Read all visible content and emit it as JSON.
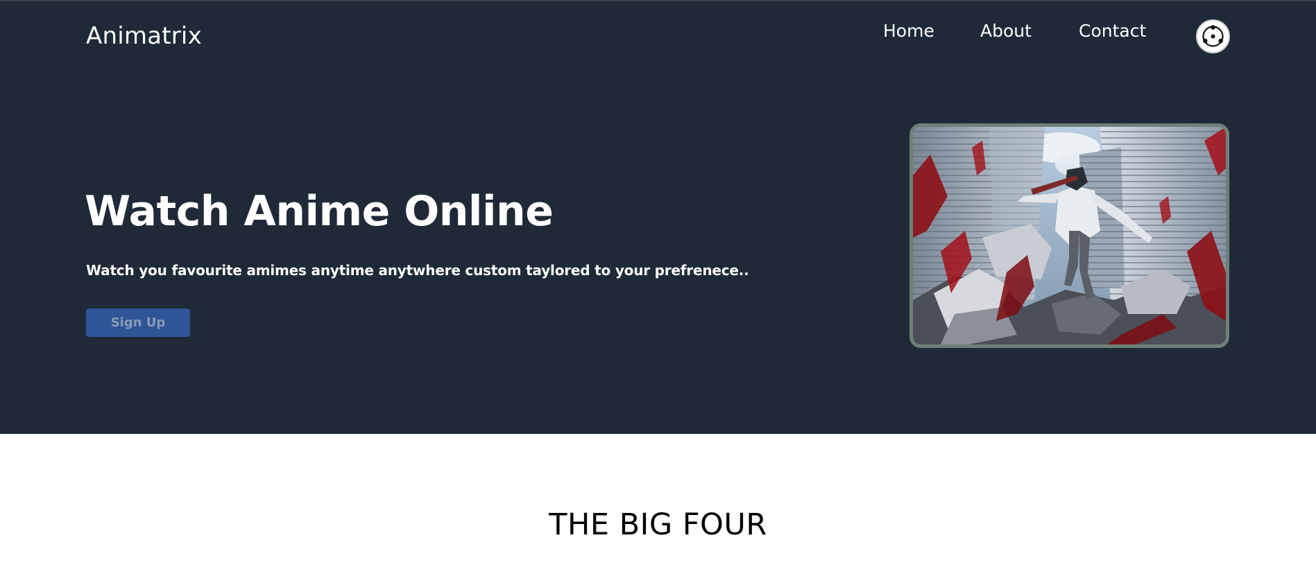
{
  "header": {
    "brand": "Animatrix",
    "nav": {
      "home": "Home",
      "about": "About",
      "contact": "Contact"
    },
    "avatar_icon": "sharingan-icon"
  },
  "hero": {
    "title": "Watch Anime Online",
    "subtitle": "Watch you favourite amimes anytime anytwhere custom taylored to your prefrenece..",
    "signup_label": "Sign Up",
    "image_subject": "anime-action-illustration"
  },
  "section": {
    "title": "THE BIG FOUR"
  },
  "colors": {
    "hero_background": "#202937",
    "button": "#2f5597",
    "button_text": "#8a9bb8",
    "image_border": "#6e8077",
    "page_background": "#ffffff"
  }
}
